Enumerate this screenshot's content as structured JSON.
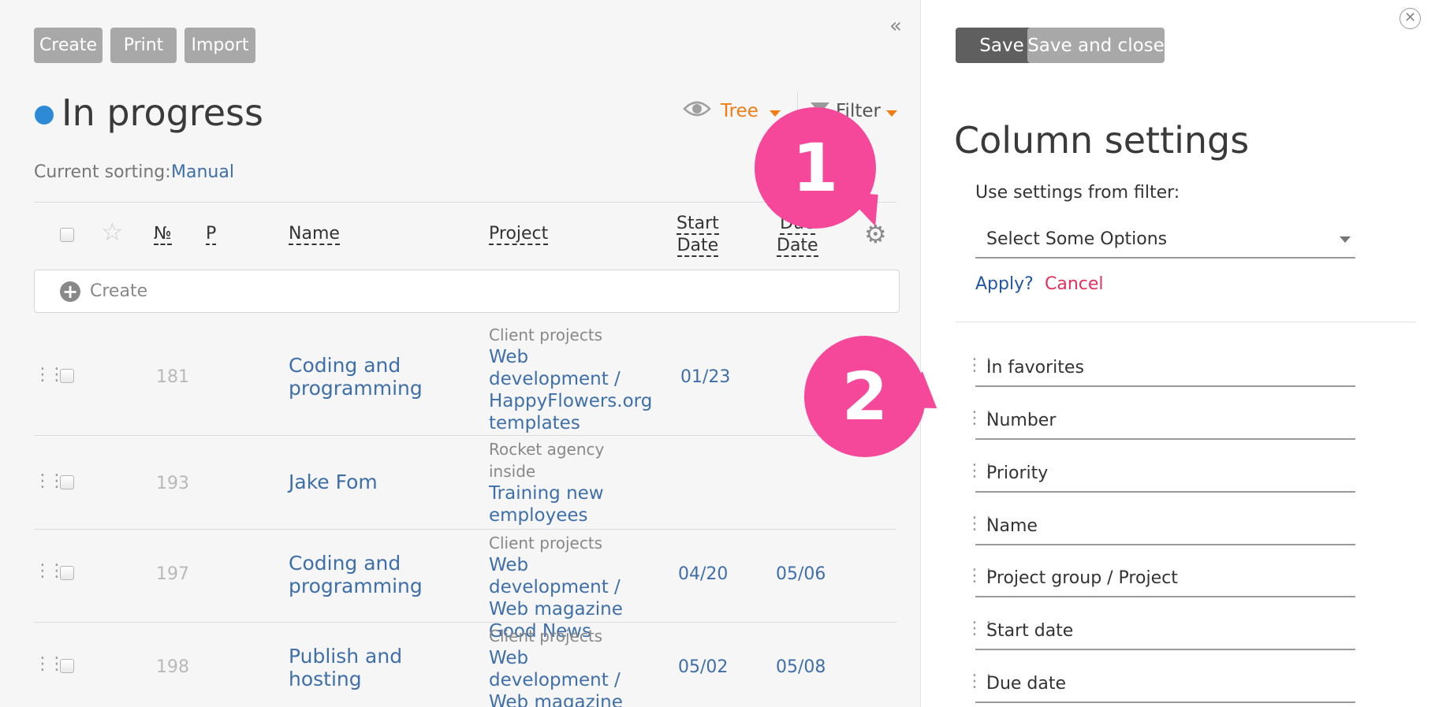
{
  "toolbar": {
    "create_label": "Create",
    "print_label": "Print",
    "import_label": "Import",
    "collapse_icon": "«"
  },
  "header": {
    "title": "In progress",
    "view_label": "Tree",
    "filter_label": "Filter"
  },
  "sorting": {
    "label": "Current sorting:",
    "value": "Manual"
  },
  "table": {
    "columns": {
      "number": "№",
      "priority": "P",
      "name": "Name",
      "project": "Project",
      "start_date_1": "Start",
      "start_date_2": "Date",
      "due_date_1": "Due",
      "due_date_2": "Date"
    },
    "create_label": "Create",
    "rows": [
      {
        "number": "181",
        "name": "Coding and programming",
        "group": "Client projects",
        "project": "Web development / HappyFlowers.org templates",
        "start": "01/23",
        "due": ""
      },
      {
        "number": "193",
        "name": "Jake Fom",
        "group": "Rocket agency inside",
        "project": "Training new employees",
        "start": "",
        "due": ""
      },
      {
        "number": "197",
        "name": "Coding and programming",
        "group": "Client projects",
        "project": "Web development / Web magazine Good News",
        "start": "04/20",
        "due": "05/06"
      },
      {
        "number": "198",
        "name": "Publish and hosting",
        "group": "Client projects",
        "project": "Web development / Web magazine Good News",
        "start": "05/02",
        "due": "05/08"
      }
    ]
  },
  "panel": {
    "save_label": "Save",
    "save_close_label": "Save and close",
    "title": "Column settings",
    "use_settings_label": "Use settings from filter:",
    "select_placeholder": "Select Some Options",
    "apply_label": "Apply?",
    "cancel_label": "Cancel",
    "columns": [
      "In favorites",
      "Number",
      "Priority",
      "Name",
      "Project group / Project",
      "Start date",
      "Due date"
    ]
  },
  "callouts": {
    "one": "1",
    "two": "2"
  },
  "colors": {
    "accent_orange": "#f07c12",
    "link_blue": "#3f6fa8",
    "callout_pink": "#f5489a",
    "status_blue": "#2d8ad6"
  }
}
